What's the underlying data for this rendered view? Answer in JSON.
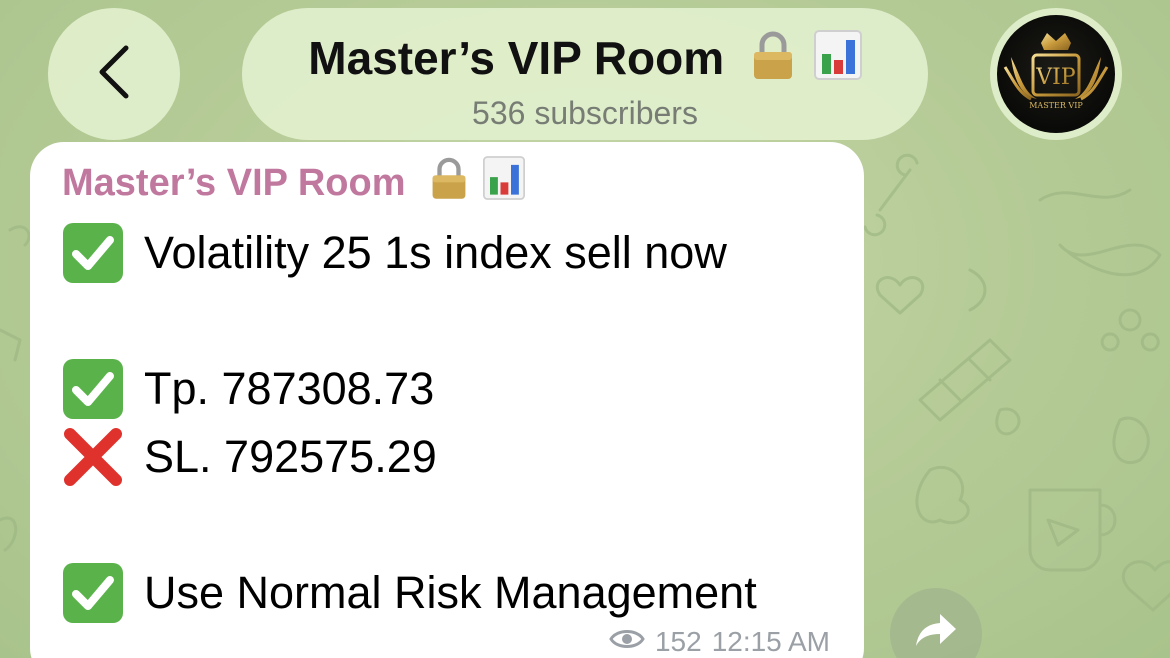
{
  "header": {
    "back_icon": "chevron-left-icon",
    "title": "Master’s VIP Room",
    "title_emoji": [
      "lock-icon",
      "bar-chart-icon"
    ],
    "subtitle": "536 subscribers",
    "avatar": {
      "icon": "vip-crown-logo",
      "logo_text": "VIP",
      "logo_caption": "MASTER VIP"
    }
  },
  "message": {
    "sender": "Master’s VIP Room",
    "sender_emoji": [
      "lock-icon",
      "bar-chart-icon"
    ],
    "lines": [
      {
        "emoji": "check-mark-icon",
        "text": "Volatility 25 1s index sell now"
      },
      {
        "emoji": "check-mark-icon",
        "text": "Tp. 787308.73"
      },
      {
        "emoji": "cross-mark-icon",
        "text": "SL. 792575.29"
      },
      {
        "emoji": "check-mark-icon",
        "text": "Use Normal Risk Management"
      }
    ],
    "views": "152",
    "time": "12:15 AM",
    "views_icon": "eye-icon"
  },
  "forward_icon": "share-arrow-icon",
  "colors": {
    "background": "#b7cc98",
    "header_pill": "#e2f0cd",
    "sender_name": "#c0789e",
    "check_green": "#5ab34a",
    "cross_red": "#e0322d",
    "meta_gray": "#9aa0a6"
  }
}
